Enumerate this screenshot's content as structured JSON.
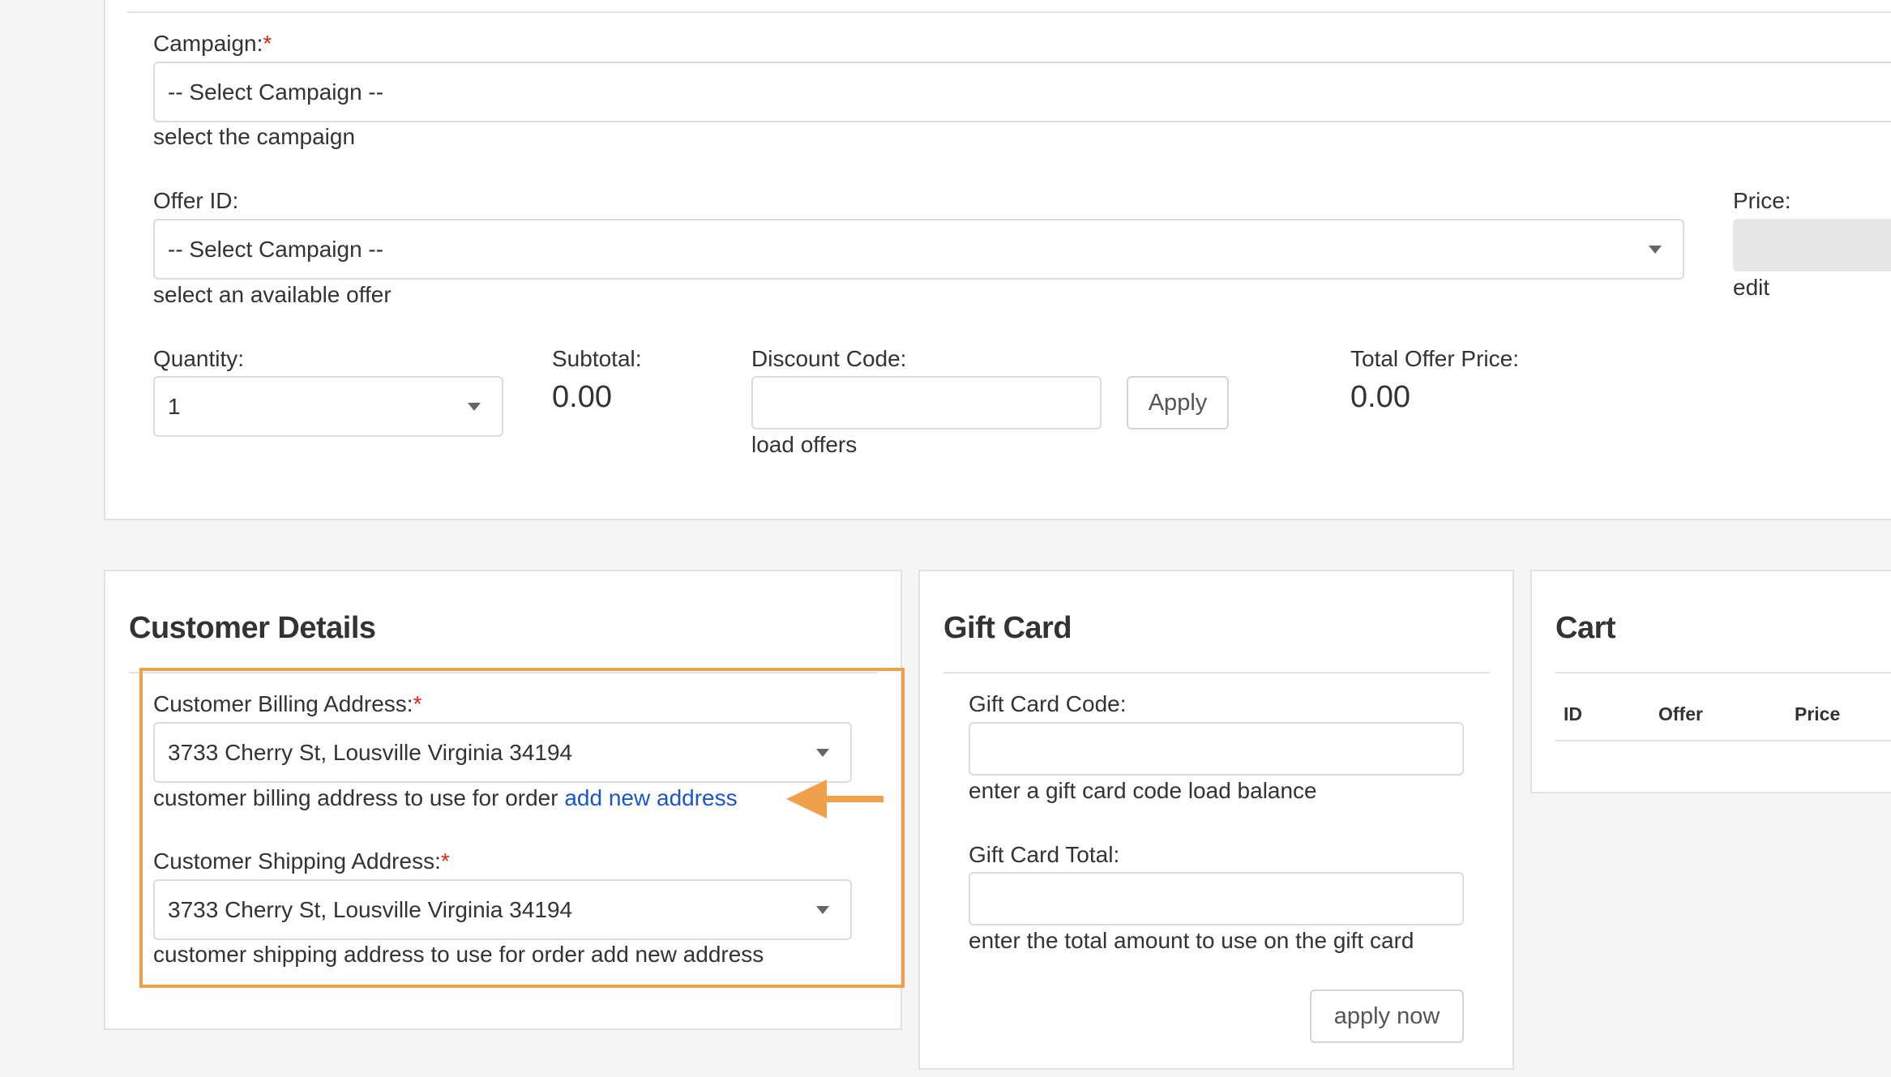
{
  "order": {
    "campaign": {
      "label": "Campaign:",
      "required_mark": "*",
      "selected": "-- Select Campaign --",
      "help": "select the campaign"
    },
    "offer": {
      "label": "Offer ID:",
      "selected": "-- Select Campaign --",
      "help": "select an available offer"
    },
    "price": {
      "label": "Price:",
      "edit_link": "edit"
    },
    "quantity": {
      "label": "Quantity:",
      "selected": "1"
    },
    "subtotal": {
      "label": "Subtotal:",
      "value": "0.00"
    },
    "discount": {
      "label": "Discount Code:",
      "value": "",
      "apply_label": "Apply",
      "help": "load offers"
    },
    "total_offer_price": {
      "label": "Total Offer Price:",
      "value": "0.00"
    }
  },
  "customer_details": {
    "title": "Customer Details",
    "billing": {
      "label": "Customer Billing Address:",
      "required_mark": "*",
      "selected": "3733 Cherry St, Lousville Virginia 34194",
      "help": "customer billing address to use for order",
      "link": "add new address"
    },
    "shipping": {
      "label": "Customer Shipping Address:",
      "required_mark": "*",
      "selected": "3733 Cherry St, Lousville Virginia 34194",
      "help": "customer shipping address to use for order add new address"
    }
  },
  "gift_card": {
    "title": "Gift Card",
    "code": {
      "label": "Gift Card Code:",
      "value": "",
      "help": "enter a gift card code load balance"
    },
    "total": {
      "label": "Gift Card Total:",
      "value": "",
      "help": "enter the total amount to use on the gift card"
    },
    "apply_label": "apply now"
  },
  "cart": {
    "title": "Cart",
    "columns": [
      "ID",
      "Offer",
      "Price"
    ]
  },
  "colors": {
    "highlight": "#f0a04b",
    "link": "#1a56c8",
    "required": "#e2231a"
  },
  "icons": {
    "dropdown": "caret-down-icon",
    "annotation": "arrow-left-icon"
  }
}
